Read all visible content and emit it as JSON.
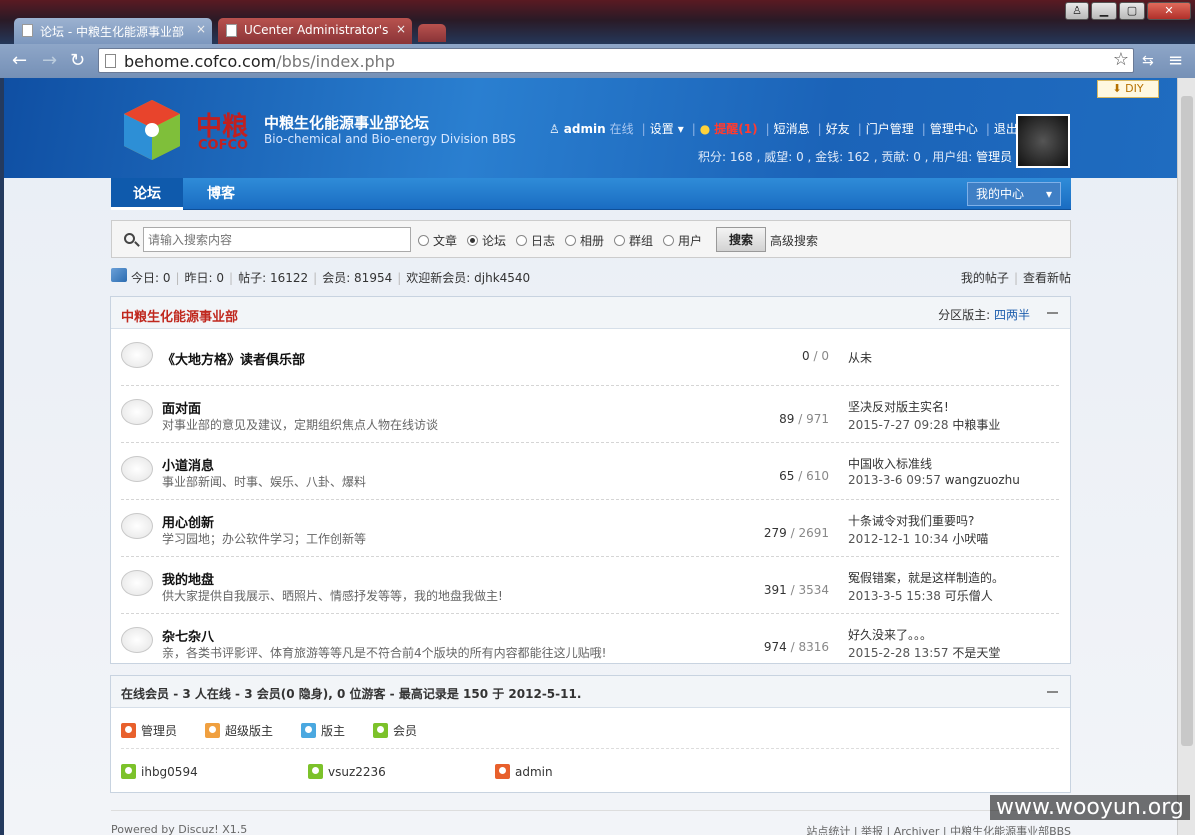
{
  "browser": {
    "tabs": [
      {
        "title": "论坛 - 中粮生化能源事业部",
        "close": "×"
      },
      {
        "title": "UCenter Administrator's",
        "close": "×"
      }
    ],
    "url_host": "behome.cofco.com",
    "url_path": "/bbs/index.php"
  },
  "header": {
    "diy": "DIY",
    "brand_cn": "中粮",
    "brand_en": "COFCO",
    "site_title": "中粮生化能源事业部论坛",
    "site_subtitle": "Bio-chemical and Bio-energy Division BBS",
    "user": {
      "name": "admin",
      "status": "在线",
      "settings": "设置",
      "remind": "提醒(1)",
      "messages": "短消息",
      "friends": "好友",
      "portal": "门户管理",
      "admin_center": "管理中心",
      "logout": "退出"
    },
    "user_stats": "积分: 168 , 威望: 0 , 金钱: 162 , 贡献: 0 , 用户组: ",
    "user_group": "管理员"
  },
  "nav": {
    "forum": "论坛",
    "blog": "博客",
    "my_center": "我的中心"
  },
  "search": {
    "placeholder": "请输入搜索内容",
    "options": [
      "文章",
      "论坛",
      "日志",
      "相册",
      "群组",
      "用户"
    ],
    "selected": "论坛",
    "button": "搜索",
    "advanced": "高级搜索"
  },
  "stats": {
    "today": "今日: 0",
    "yesterday": "昨日: 0",
    "posts": "帖子: 16122",
    "members": "会员: 81954",
    "newest": "欢迎新会员: djhk4540",
    "my_posts": "我的帖子",
    "new_posts": "查看新帖"
  },
  "category": {
    "title": "中粮生化能源事业部",
    "moderator_label": "分区版主: ",
    "moderator": "四两半"
  },
  "forums": [
    {
      "name": "《大地方格》读者俱乐部",
      "desc": "",
      "threads": "0",
      "posts": "0",
      "last_title": "从未",
      "last_time": "",
      "last_user": ""
    },
    {
      "name": "面对面",
      "desc": "对事业部的意见及建议，定期组织焦点人物在线访谈",
      "threads": "89",
      "posts": "971",
      "last_title": "坚决反对版主实名!",
      "last_time": "2015-7-27 09:28",
      "last_user": "中粮事业"
    },
    {
      "name": "小道消息",
      "desc": "事业部新闻、时事、娱乐、八卦、爆料",
      "threads": "65",
      "posts": "610",
      "last_title": "中国收入标准线",
      "last_time": "2013-3-6 09:57",
      "last_user": "wangzuozhu"
    },
    {
      "name": "用心创新",
      "desc": "学习园地；办公软件学习；工作创新等",
      "threads": "279",
      "posts": "2691",
      "last_title": "十条诫令对我们重要吗?",
      "last_time": "2012-12-1 10:34",
      "last_user": "小吠喵"
    },
    {
      "name": "我的地盘",
      "desc": "供大家提供自我展示、晒照片、情感抒发等等，我的地盘我做主!",
      "threads": "391",
      "posts": "3534",
      "last_title": "冤假错案，就是这样制造的。",
      "last_time": "2013-3-5 15:38",
      "last_user": "可乐僧人"
    },
    {
      "name": "杂七杂八",
      "desc": "亲，各类书评影评、体育旅游等等凡是不符合前4个版块的所有内容都能往这儿贴哦!",
      "threads": "974",
      "posts": "8316",
      "last_title": "好久没来了。。。",
      "last_time": "2015-2-28 13:57",
      "last_user": "不是天堂"
    }
  ],
  "online": {
    "label": "在线会员",
    "summary": " - 3 人在线 - 3 会员(0 隐身), 0 位游客 - 最高记录是 150 于 2012-5-11.",
    "legend": [
      {
        "label": "管理员",
        "color": "#e8602c"
      },
      {
        "label": "超级版主",
        "color": "#f0a040"
      },
      {
        "label": "版主",
        "color": "#4aa8e0"
      },
      {
        "label": "会员",
        "color": "#7cc22a"
      }
    ],
    "users": [
      {
        "name": "ihbg0594",
        "color": "#7cc22a"
      },
      {
        "name": "vsuz2236",
        "color": "#7cc22a"
      },
      {
        "name": "admin",
        "color": "#e8602c"
      }
    ]
  },
  "footer": {
    "powered": "Powered by Discuz! X1.5",
    "links": "站点统计 | 举报 | Archiver | 中粮生化能源事业部BBS"
  },
  "watermark": "www.wooyun.org"
}
